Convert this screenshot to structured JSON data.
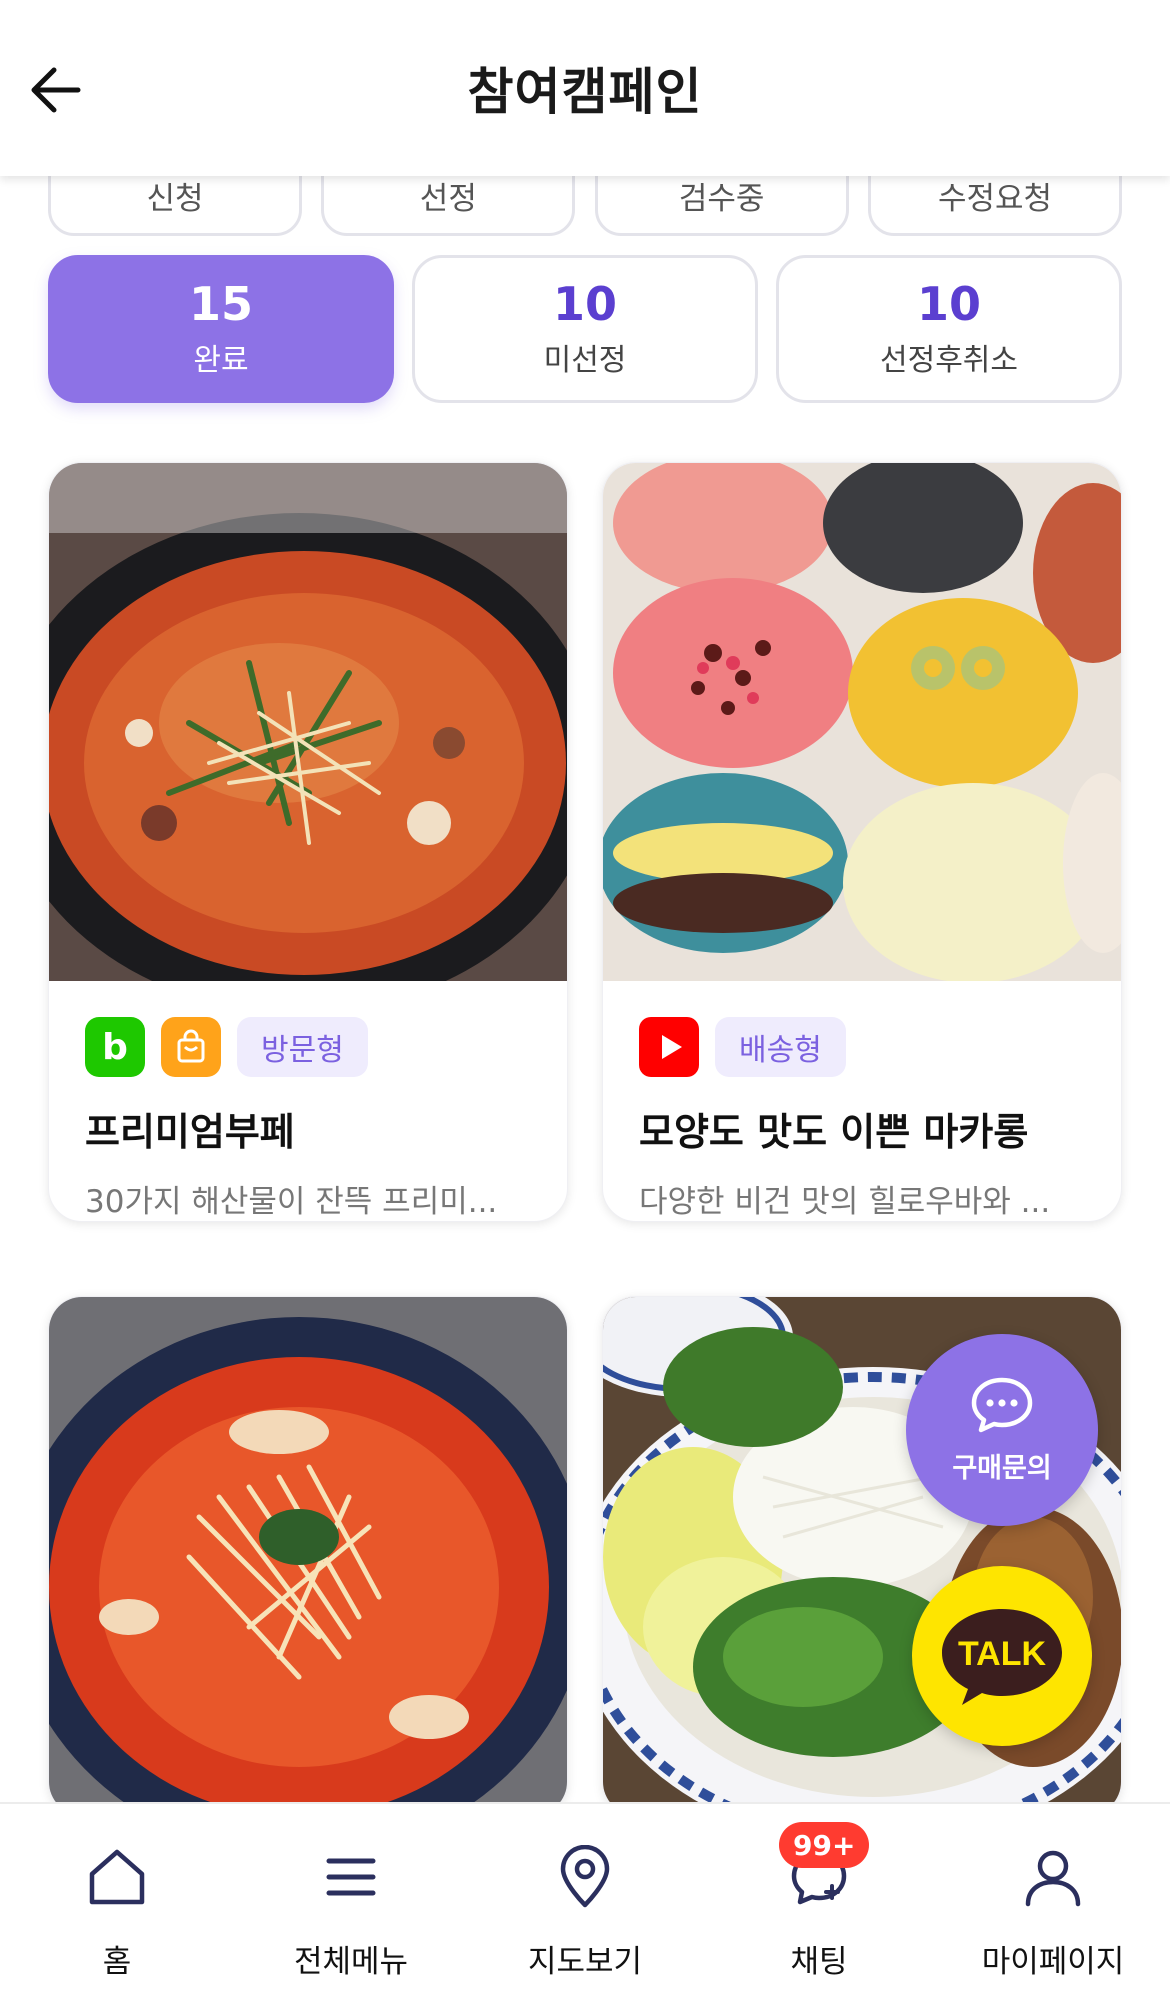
{
  "header": {
    "title": "참여캠페인"
  },
  "top_tabs": [
    {
      "label": "신청"
    },
    {
      "label": "선정"
    },
    {
      "label": "검수중"
    },
    {
      "label": "수정요청"
    }
  ],
  "status_cards": [
    {
      "count": "15",
      "label": "완료",
      "active": true
    },
    {
      "count": "10",
      "label": "미선정",
      "active": false
    },
    {
      "count": "10",
      "label": "선정후취소",
      "active": false
    }
  ],
  "campaigns": [
    {
      "title": "프리미엄부페",
      "description": "30가지 해산물이 잔뜩 프리미...",
      "type": "방문형",
      "icons": [
        "blog-icon",
        "shopping-bag-icon"
      ],
      "image": "spicy-hotpot-photo"
    },
    {
      "title": "모양도 맛도 이쁜 마카롱",
      "description": "다양한 비건 맛의 힐로우바와 ...",
      "type": "배송형",
      "icons": [
        "youtube-icon"
      ],
      "image": "macarons-photo"
    },
    {
      "title": "",
      "description": "",
      "type": "",
      "icons": [],
      "image": "kimchi-stew-photo"
    },
    {
      "title": "",
      "description": "",
      "type": "",
      "icons": [],
      "image": "noodle-salad-platter-photo"
    }
  ],
  "floating": {
    "inquiry_label": "구매문의",
    "talk_label": "TALK"
  },
  "bottom_nav": [
    {
      "label": "홈",
      "icon": "home-icon"
    },
    {
      "label": "전체메뉴",
      "icon": "menu-icon"
    },
    {
      "label": "지도보기",
      "icon": "map-pin-icon"
    },
    {
      "label": "채팅",
      "icon": "chat-icon",
      "badge": "99+"
    },
    {
      "label": "마이페이지",
      "icon": "user-icon"
    }
  ],
  "colors": {
    "accent": "#8d72e6",
    "accent_text": "#5b3fd0",
    "tag_bg": "#efecfd",
    "badge_red": "#ff3b30",
    "kakao_yellow": "#fee500"
  }
}
